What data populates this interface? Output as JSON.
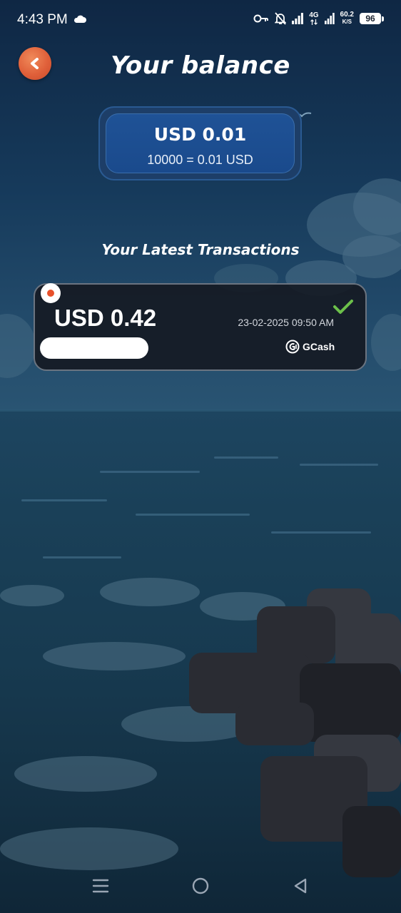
{
  "status_bar": {
    "time": "4:43 PM",
    "network_label": "4G",
    "speed_value": "60.2",
    "speed_unit": "K/S",
    "battery_level": "96"
  },
  "header": {
    "title": "Your balance",
    "back_icon": "chevron-left-icon"
  },
  "balance": {
    "amount": "USD 0.01",
    "rate": "10000 = 0.01 USD"
  },
  "transactions_section": {
    "title": "Your Latest Transactions"
  },
  "transactions": [
    {
      "amount": "USD 0.42",
      "date": "23-02-2025 09:50 AM",
      "method": "GCash",
      "status_icon": "checkmark-icon",
      "status_color": "#6cc04a",
      "indicator_color": "#e8512b"
    }
  ],
  "colors": {
    "accent_orange": "#e0603a",
    "balance_blue": "#1f5296",
    "success_green": "#6cc04a"
  }
}
